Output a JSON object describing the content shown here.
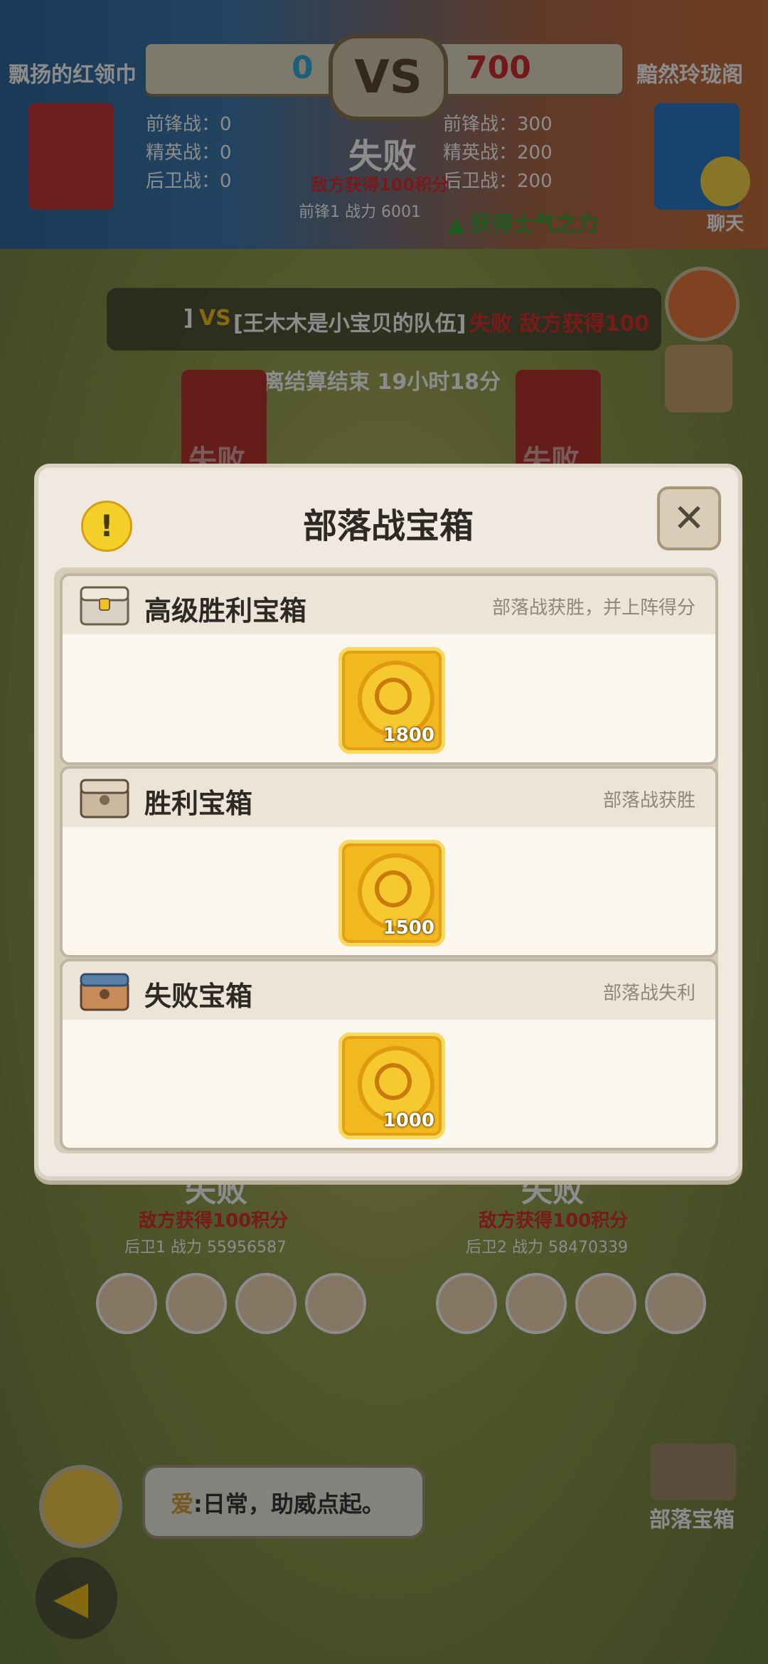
{
  "battle": {
    "left_team": "飘扬的红领巾",
    "right_team": "黯然玲珑阁",
    "left_score": "0",
    "right_score": "700",
    "vs_label": "VS",
    "left_stats": [
      "前锋战：0",
      "精英战：0",
      "后卫战：0"
    ],
    "right_stats": [
      "前锋战：300",
      "精英战：200",
      "后卫战：200"
    ],
    "top_result": "失败",
    "top_bonus": "敌方获得100积分",
    "top_power": "前锋1 战力 6001",
    "morale": "获得士气之力",
    "chat_label": "聊天",
    "ticker_bracket": "]",
    "ticker_vs": "VS",
    "ticker_team": "[王木木是小宝贝的队伍]",
    "ticker_red": "失败 敌方获得100",
    "countdown": "距离结算结束  19小时18分",
    "ghost_fail": "失败"
  },
  "modal": {
    "title": "部落战宝箱",
    "close_label": "✕",
    "warn_label": "!",
    "rows": [
      {
        "title": "高级胜利宝箱",
        "desc": "部落战获胜，并上阵得分",
        "reward": "1800",
        "chest_color": "#d9d2c4"
      },
      {
        "title": "胜利宝箱",
        "desc": "部落战获胜",
        "reward": "1500",
        "chest_color": "#c9b9a0"
      },
      {
        "title": "失败宝箱",
        "desc": "部落战失利",
        "reward": "1000",
        "chest_color": "#5a7fa8"
      }
    ]
  },
  "lower": {
    "left_result": "失败",
    "right_result": "失败",
    "left_bonus": "敌方获得100积分",
    "right_bonus": "敌方获得100积分",
    "left_power": "后卫1  战力  55956587",
    "right_power": "后卫2  战力  58470339",
    "chat_who": "爱",
    "chat_msg": ":日常，助威点起。",
    "tribe_chest_label": "部落宝箱",
    "back_label": "◀"
  }
}
